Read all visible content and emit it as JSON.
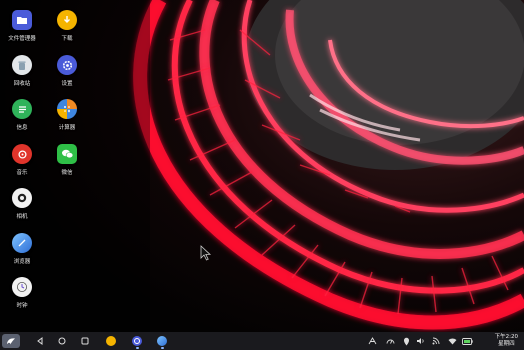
{
  "desktop": {
    "icons": [
      {
        "label": "文件管理器",
        "icon": "folder-icon",
        "color": "#4a5bd9"
      },
      {
        "label": "下载",
        "icon": "download-icon",
        "color": "#f5b400"
      },
      {
        "label": "回收站",
        "icon": "trash-icon",
        "color": "#cfd8dc"
      },
      {
        "label": "设置",
        "icon": "gear-icon",
        "color": "#4a5bd9"
      },
      {
        "label": "信息",
        "icon": "message-icon",
        "color": "#2fb35a"
      },
      {
        "label": "计算器",
        "icon": "calculator-icon",
        "color": "#f08a24"
      },
      {
        "label": "音乐",
        "icon": "music-icon",
        "color": "#e0342b"
      },
      {
        "label": "微信",
        "icon": "wechat-icon",
        "color": "#2fbf47"
      },
      {
        "label": "相机",
        "icon": "camera-icon",
        "color": "#f2f2f2"
      },
      {
        "label": "浏览器",
        "icon": "browser-icon",
        "color": "#3f86e0"
      },
      {
        "label": "时钟",
        "icon": "clock-icon",
        "color": "#f2f2f2"
      }
    ]
  },
  "taskbar": {
    "start_icon": "start-logo-icon",
    "nav": [
      "back-icon",
      "home-icon",
      "recents-icon"
    ],
    "pinned": [
      {
        "icon": "app-yellow-icon",
        "color": "#f5b400"
      },
      {
        "icon": "settings-app-icon",
        "color": "#4a5bd9"
      },
      {
        "icon": "browser-app-icon",
        "color": "#3f86e0"
      }
    ],
    "tray": [
      "keyboard-icon",
      "speedometer-icon",
      "location-icon",
      "volume-icon",
      "rss-icon",
      "wifi-icon",
      "battery-icon"
    ],
    "clock": {
      "time": "下午2:20",
      "day": "星期四"
    }
  }
}
